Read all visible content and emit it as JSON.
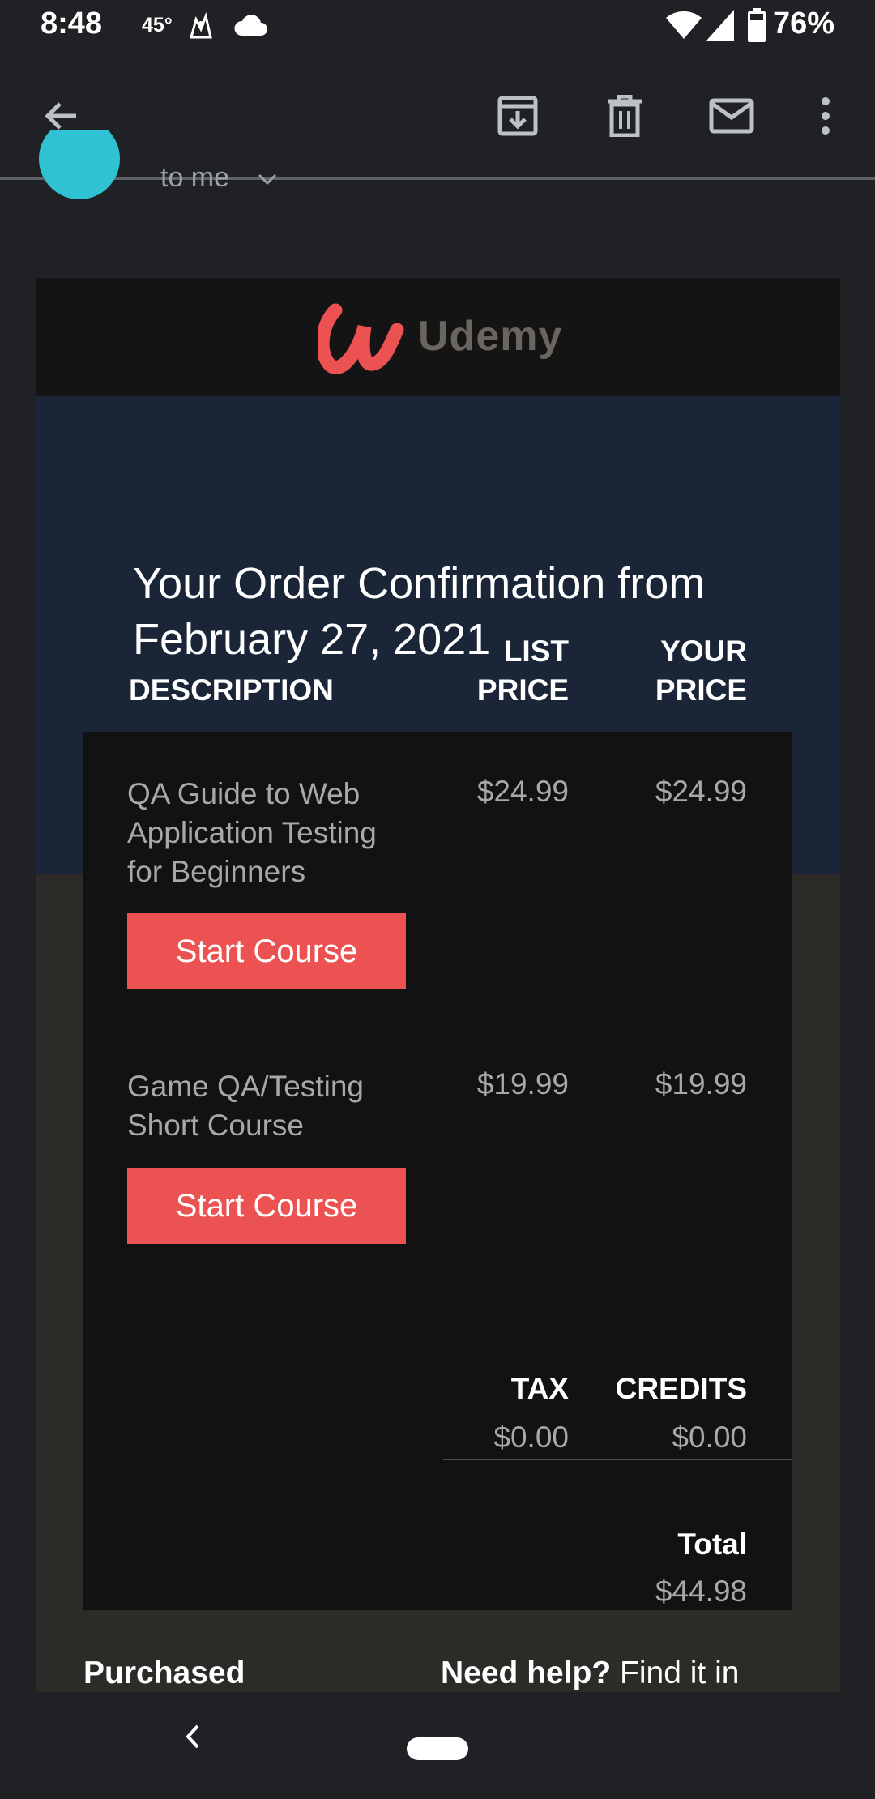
{
  "status_bar": {
    "time": "8:48",
    "temperature": "45°",
    "battery": "76%",
    "icons": [
      "weather-app-icon",
      "cloud-icon",
      "wifi-icon",
      "signal-icon",
      "battery-icon"
    ]
  },
  "app_bar": {
    "icons": [
      "back-arrow-icon",
      "archive-icon",
      "delete-icon",
      "mark-unread-icon",
      "more-vert-icon"
    ]
  },
  "header": {
    "recipient": "to me"
  },
  "email": {
    "logo_text": "Udemy",
    "title": "Your Order Confirmation from February 27, 2021",
    "table": {
      "col_description": "DESCRIPTION",
      "col_list_price_1": "LIST",
      "col_list_price_2": "PRICE",
      "col_your_price_1": "YOUR",
      "col_your_price_2": "PRICE"
    },
    "items": [
      {
        "name": "QA Guide to Web Application Testing for Beginners",
        "list_price": "$24.99",
        "your_price": "$24.99",
        "button": "Start Course"
      },
      {
        "name": "Game QA/Testing Short Course",
        "list_price": "$19.99",
        "your_price": "$19.99",
        "button": "Start Course"
      }
    ],
    "summary": {
      "tax_label": "TAX",
      "tax_value": "$0.00",
      "credits_label": "CREDITS",
      "credits_value": "$0.00",
      "total_label": "Total",
      "total_value": "$44.98"
    },
    "footer": {
      "purchased": "Purchased",
      "help_bold": "Need help?",
      "help_rest": "Find it in"
    }
  },
  "colors": {
    "background": "#202124",
    "button": "#ec5252",
    "title_band": "#1b2538",
    "brand": "#ec5252"
  }
}
